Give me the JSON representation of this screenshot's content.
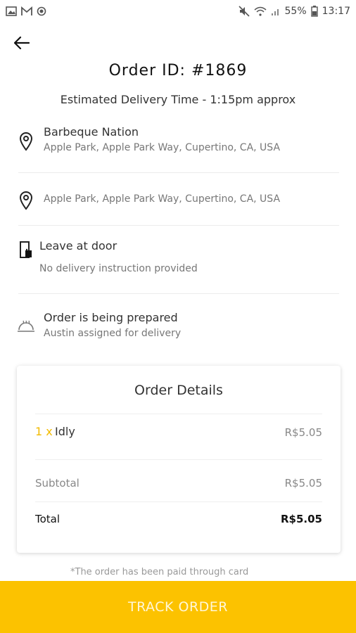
{
  "status_bar": {
    "battery": "55%",
    "time": "13:17"
  },
  "header": {
    "title": "Order ID: #1869",
    "eta": "Estimated Delivery Time - 1:15pm approx"
  },
  "restaurant": {
    "name": "Barbeque Nation",
    "address": "Apple Park, Apple Park Way, Cupertino, CA, USA"
  },
  "delivery": {
    "address": "Apple Park, Apple Park Way, Cupertino, CA, USA"
  },
  "instructions": {
    "title": "Leave at door",
    "subtitle": "No delivery instruction provided"
  },
  "order_status": {
    "title": "Order is being prepared",
    "subtitle": "Austin assigned for delivery"
  },
  "order_details": {
    "title": "Order Details",
    "items": [
      {
        "qty": "1 x",
        "name": "Idly",
        "price": "R$5.05"
      }
    ],
    "subtotal_label": "Subtotal",
    "subtotal_value": "R$5.05",
    "total_label": "Total",
    "total_value": "R$5.05"
  },
  "footer_note": "*The order has been paid through card",
  "track_button": "TRACK ORDER",
  "colors": {
    "accent": "#fcc200",
    "qty": "#f2bb00"
  }
}
